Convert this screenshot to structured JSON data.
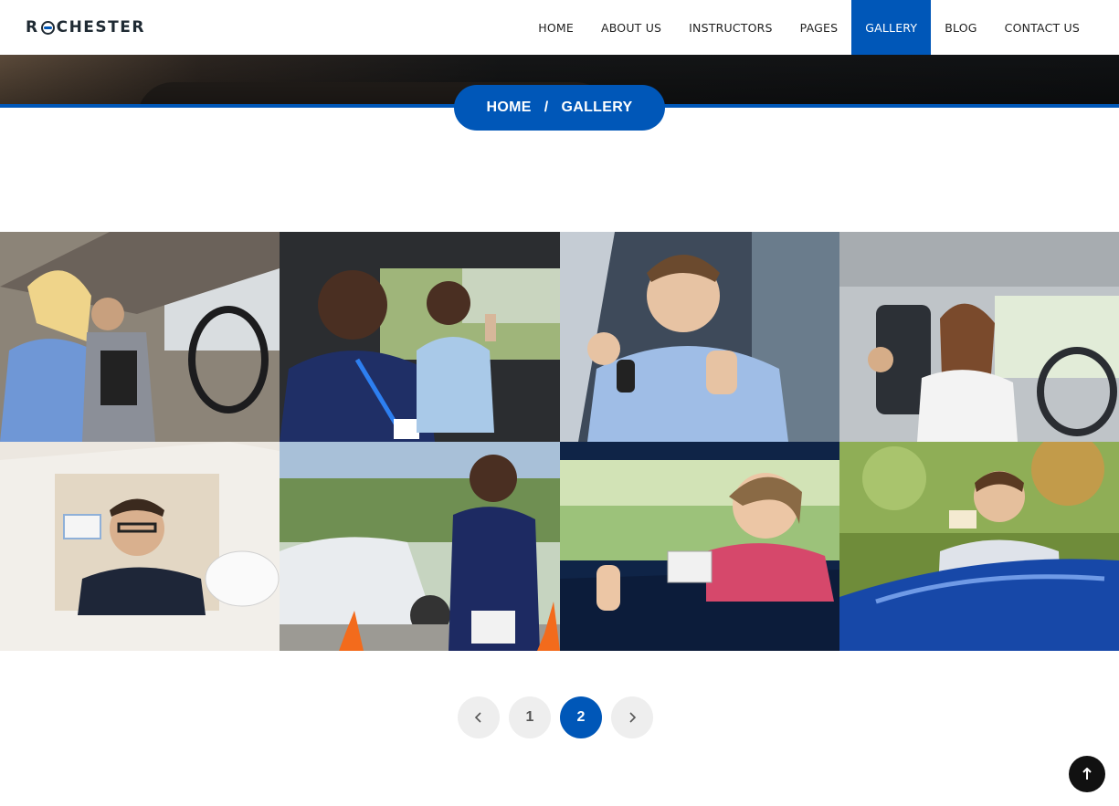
{
  "header": {
    "logo_text": "ROCHESTER",
    "nav": [
      {
        "label": "HOME"
      },
      {
        "label": "ABOUT US"
      },
      {
        "label": "INSTRUCTORS"
      },
      {
        "label": "PAGES"
      },
      {
        "label": "GALLERY",
        "active": true
      },
      {
        "label": "BLOG"
      },
      {
        "label": "CONTACT US"
      }
    ]
  },
  "breadcrumb": {
    "home": "HOME",
    "separator": "/",
    "current": "GALLERY"
  },
  "gallery": {
    "photos": [
      "Woman smiling at steering wheel with instructor",
      "Instructor and student giving thumbs up in car",
      "Young man holding car key giving thumbs up",
      "Woman driving with child in back seat",
      "Man in white car showing driver license",
      "Instructor standing by car with traffic cones",
      "Young woman showing license from car window",
      "Young man showing license leaning on blue car"
    ]
  },
  "pagination": {
    "prev_icon": "chevron-left-icon",
    "pages": [
      "1",
      "2"
    ],
    "current": "2",
    "next_icon": "chevron-right-icon"
  },
  "scroll_top_icon": "arrow-up-icon",
  "colors": {
    "brand": "#0057b8",
    "dark": "#111111"
  }
}
